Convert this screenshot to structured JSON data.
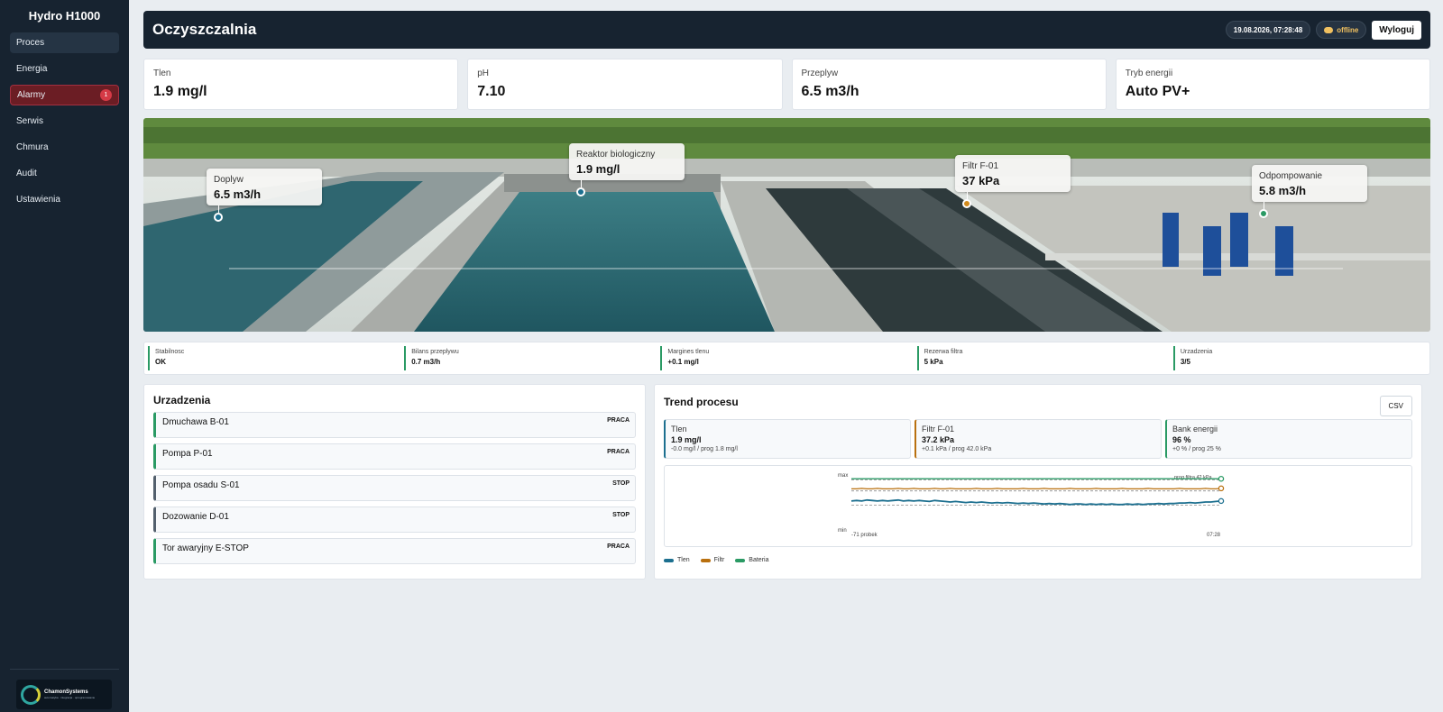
{
  "app": {
    "title": "Hydro H1000"
  },
  "sidebar": {
    "items": [
      {
        "label": "Proces"
      },
      {
        "label": "Energia"
      },
      {
        "label": "Alarmy",
        "badge": "1"
      },
      {
        "label": "Serwis"
      },
      {
        "label": "Chmura"
      },
      {
        "label": "Audit"
      },
      {
        "label": "Ustawienia"
      }
    ],
    "logo": {
      "name": "ChamonSystems",
      "tagline": "automatyka · integracja · oprogramowanie"
    }
  },
  "header": {
    "title": "Oczyszczalnia",
    "datetime": "19.08.2026, 07:28:48",
    "connection": "offline",
    "logout_label": "Wyloguj"
  },
  "kpis": [
    {
      "label": "Tlen",
      "value": "1.9 mg/l"
    },
    {
      "label": "pH",
      "value": "7.10"
    },
    {
      "label": "Przeplyw",
      "value": "6.5 m3/h"
    },
    {
      "label": "Tryb energii",
      "value": "Auto PV+"
    }
  ],
  "scene": {
    "callouts": [
      {
        "label": "Doplyw",
        "value": "6.5 m3/h",
        "color": "#1c6f8f"
      },
      {
        "label": "Reaktor biologiczny",
        "value": "1.9 mg/l",
        "color": "#1c6f8f"
      },
      {
        "label": "Filtr F-01",
        "value": "37 kPa",
        "color": "#d28a1c"
      },
      {
        "label": "Odpompowanie",
        "value": "5.8 m3/h",
        "color": "#2a9a64"
      }
    ]
  },
  "stats": [
    {
      "label": "Stabilnosc",
      "value": "OK"
    },
    {
      "label": "Bilans przeplywu",
      "value": "0.7 m3/h"
    },
    {
      "label": "Margines tlenu",
      "value": "+0.1 mg/l"
    },
    {
      "label": "Rezerwa filtra",
      "value": "5 kPa"
    },
    {
      "label": "Urzadzenia",
      "value": "3/5"
    }
  ],
  "devices": {
    "title": "Urzadzenia",
    "items": [
      {
        "name": "Dmuchawa B-01",
        "status": "PRACA"
      },
      {
        "name": "Pompa P-01",
        "status": "PRACA"
      },
      {
        "name": "Pompa osadu S-01",
        "status": "STOP"
      },
      {
        "name": "Dozowanie D-01",
        "status": "STOP"
      },
      {
        "name": "Tor awaryjny E-STOP",
        "status": "PRACA"
      }
    ]
  },
  "trend": {
    "title": "Trend procesu",
    "csv_label": "CSV",
    "cards": [
      {
        "label": "Tlen",
        "value": "1.9 mg/l",
        "detail": "-0.0 mg/l / prog 1.8 mg/l"
      },
      {
        "label": "Filtr F-01",
        "value": "37.2 kPa",
        "detail": "+0.1 kPa / prog 42.0 kPa"
      },
      {
        "label": "Bank energii",
        "value": "96 %",
        "detail": "+0 % / prog 25 %"
      }
    ],
    "legend": [
      {
        "name": "Tlen",
        "color": "#1c6f8f"
      },
      {
        "name": "Filtr",
        "color": "#b9700f"
      },
      {
        "name": "Bateria",
        "color": "#2a9a64"
      }
    ]
  },
  "chart_data": {
    "type": "line",
    "ytick_labels": [
      "max",
      "min"
    ],
    "xtick_labels": [
      "-71 probek",
      "07:28"
    ],
    "annotation": "prog filtra 42 kPa",
    "x_count": 72,
    "series": [
      {
        "name": "Tlen",
        "color": "#1c6f8f",
        "values": [
          0.52,
          0.53,
          0.52,
          0.54,
          0.53,
          0.52,
          0.53,
          0.52,
          0.53,
          0.54,
          0.52,
          0.53,
          0.52,
          0.53,
          0.52,
          0.51,
          0.53,
          0.52,
          0.51,
          0.5,
          0.51,
          0.5,
          0.49,
          0.5,
          0.49,
          0.5,
          0.49,
          0.48,
          0.49,
          0.48,
          0.49,
          0.48,
          0.47,
          0.48,
          0.47,
          0.48,
          0.47,
          0.46,
          0.47,
          0.46,
          0.47,
          0.46,
          0.45,
          0.46,
          0.46,
          0.45,
          0.46,
          0.45,
          0.46,
          0.45,
          0.46,
          0.45,
          0.45,
          0.46,
          0.45,
          0.46,
          0.45,
          0.46,
          0.46,
          0.47,
          0.46,
          0.47,
          0.47,
          0.48,
          0.48,
          0.49,
          0.48,
          0.49,
          0.5,
          0.5,
          0.51,
          0.52
        ]
      },
      {
        "name": "Filtr",
        "color": "#b9700f",
        "values": [
          0.76,
          0.76,
          0.77,
          0.76,
          0.76,
          0.77,
          0.76,
          0.76,
          0.76,
          0.77,
          0.76,
          0.76,
          0.77,
          0.76,
          0.76,
          0.76,
          0.77,
          0.76,
          0.76,
          0.77,
          0.76,
          0.76,
          0.76,
          0.76,
          0.77,
          0.76,
          0.76,
          0.76,
          0.77,
          0.76,
          0.76,
          0.76,
          0.76,
          0.77,
          0.76,
          0.76,
          0.76,
          0.77,
          0.76,
          0.76,
          0.76,
          0.76,
          0.77,
          0.76,
          0.76,
          0.76,
          0.76,
          0.77,
          0.76,
          0.76,
          0.76,
          0.76,
          0.77,
          0.76,
          0.76,
          0.76,
          0.76,
          0.77,
          0.76,
          0.76,
          0.76,
          0.76,
          0.76,
          0.77,
          0.76,
          0.76,
          0.76,
          0.76,
          0.77,
          0.76,
          0.76,
          0.77
        ]
      },
      {
        "name": "Bateria",
        "color": "#2a9a64",
        "values": [
          0.96,
          0.96,
          0.96,
          0.96,
          0.96,
          0.96,
          0.96,
          0.96,
          0.96,
          0.96,
          0.96,
          0.96,
          0.96,
          0.96,
          0.96,
          0.96,
          0.96,
          0.96,
          0.96,
          0.96,
          0.96,
          0.96,
          0.96,
          0.96,
          0.96,
          0.96,
          0.96,
          0.96,
          0.96,
          0.96,
          0.96,
          0.96,
          0.96,
          0.96,
          0.96,
          0.96,
          0.96,
          0.96,
          0.96,
          0.96,
          0.96,
          0.96,
          0.96,
          0.96,
          0.96,
          0.96,
          0.96,
          0.96,
          0.96,
          0.96,
          0.96,
          0.96,
          0.96,
          0.96,
          0.96,
          0.96,
          0.96,
          0.96,
          0.96,
          0.96,
          0.96,
          0.96,
          0.96,
          0.96,
          0.96,
          0.96,
          0.96,
          0.96,
          0.96,
          0.96,
          0.96,
          0.96
        ]
      }
    ],
    "threshold_lines": [
      0.44,
      0.72,
      0.94
    ],
    "ylim": [
      0,
      1
    ],
    "grid": false,
    "legend_position": "bottom-left"
  }
}
